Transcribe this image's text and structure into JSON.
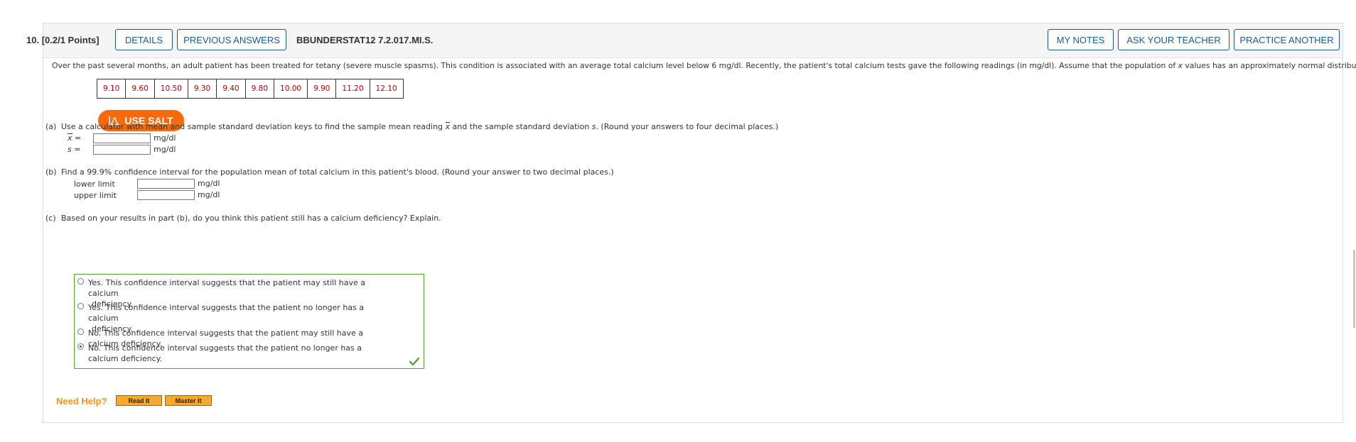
{
  "header": {
    "number": "10.",
    "points": "[0.2/1 Points]",
    "details_label": "DETAILS",
    "prev_answers_label": "PREVIOUS ANSWERS",
    "code": "BBUNDERSTAT12 7.2.017.MI.S.",
    "my_notes_label": "MY NOTES",
    "ask_teacher_label": "ASK YOUR TEACHER",
    "practice_label": "PRACTICE ANOTHER"
  },
  "intro": {
    "before_x": "Over the past several months, an adult patient has been treated for tetany (severe muscle spasms). This condition is associated with an average total calcium level below 6 mg/dl. Recently, the patient's total calcium tests gave the following readings (in mg/dl). Assume that the population of ",
    "x": "x",
    "after_x": " values has an approximately normal distribution."
  },
  "readings": [
    "9.10",
    "9.60",
    "10.50",
    "9.30",
    "9.40",
    "9.80",
    "10.00",
    "9.90",
    "11.20",
    "12.10"
  ],
  "salt_label": "USE SALT",
  "part_a": {
    "label": "(a)",
    "text_before": "Use a calculator with mean and sample standard deviation keys to find the sample mean reading ",
    "xbar": "x",
    "text_middle": " and the sample standard deviation ",
    "s": "s",
    "text_after": ". (Round your answers to four decimal places.)",
    "xbar_label": "x",
    "s_label": "s",
    "eq": "=",
    "xbar_value": "",
    "s_value": "",
    "unit": "mg/dl"
  },
  "part_b": {
    "label": "(b)",
    "text": "Find a 99.9% confidence interval for the population mean of total calcium in this patient's blood. (Round your answer to two decimal places.)",
    "lower_label": "lower limit",
    "upper_label": "upper limit",
    "lower_value": "",
    "upper_value": "",
    "unit": "mg/dl"
  },
  "part_c": {
    "label": "(c)",
    "text": "Based on your results in part (b), do you think this patient still has a calcium deficiency? Explain.",
    "choices": [
      {
        "line1": "Yes. This confidence interval suggests that the patient may still have a calcium",
        "line2": "deficiency."
      },
      {
        "line1": "Yes. This confidence interval suggests that the patient no longer has a calcium",
        "line2": "deficiency."
      },
      {
        "line1": "No. This confidence interval suggests that the patient may still have a calcium deficiency.",
        "line2": ""
      },
      {
        "line1": "No. This confidence interval suggests that the patient no longer has a calcium deficiency.",
        "line2": ""
      }
    ],
    "selected_index": 3
  },
  "help": {
    "label": "Need Help?",
    "read_it": "Read It",
    "master_it": "Master It"
  },
  "colors": {
    "link_blue": "#1d5a8a",
    "salt_orange": "#f76a0c",
    "reading_red": "#c00000",
    "correct_green": "#5aa02c",
    "help_orange": "#f7941d"
  }
}
